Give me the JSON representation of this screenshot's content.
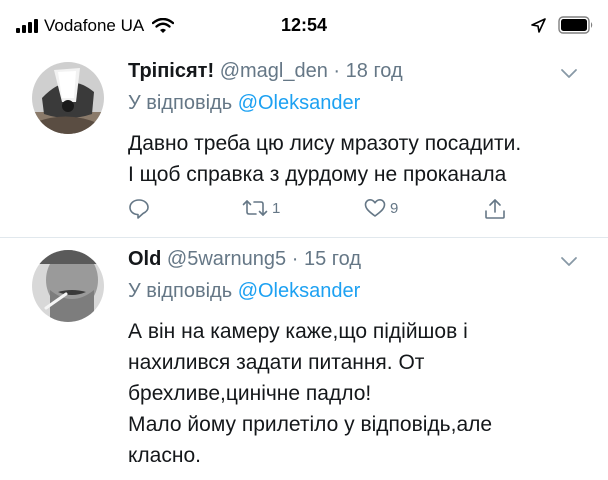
{
  "status_bar": {
    "carrier": "Vodafone UA",
    "time": "12:54"
  },
  "tweets": [
    {
      "display_name": "Тріпісят!",
      "handle": "@magl_den",
      "separator": "·",
      "time": "18 год",
      "reply_prefix": "У відповідь",
      "reply_to": "@Oleksander",
      "text_lines": [
        "Давно треба цю лису мразоту посадити.",
        "І щоб справка з дурдому не проканала"
      ],
      "retweet_count": "1",
      "like_count": "9"
    },
    {
      "display_name": "Old",
      "handle": "@5warnung5",
      "separator": "·",
      "time": "15 год",
      "reply_prefix": "У відповідь",
      "reply_to": "@Oleksander",
      "text_lines": [
        "А він на камеру каже,що підійшов і",
        "нахилився задати питання. От",
        "брехливе,цинічне падло!",
        "Мало йому прилетіло у відповідь,але",
        "класно."
      ]
    }
  ],
  "colors": {
    "accent": "#1da1f2",
    "secondary_text": "#657786",
    "divider": "#e1e8ed"
  },
  "icons": [
    "signal-icon",
    "wifi-icon",
    "location-arrow-icon",
    "battery-icon",
    "chevron-down-icon",
    "reply-icon",
    "retweet-icon",
    "like-icon",
    "share-icon"
  ]
}
